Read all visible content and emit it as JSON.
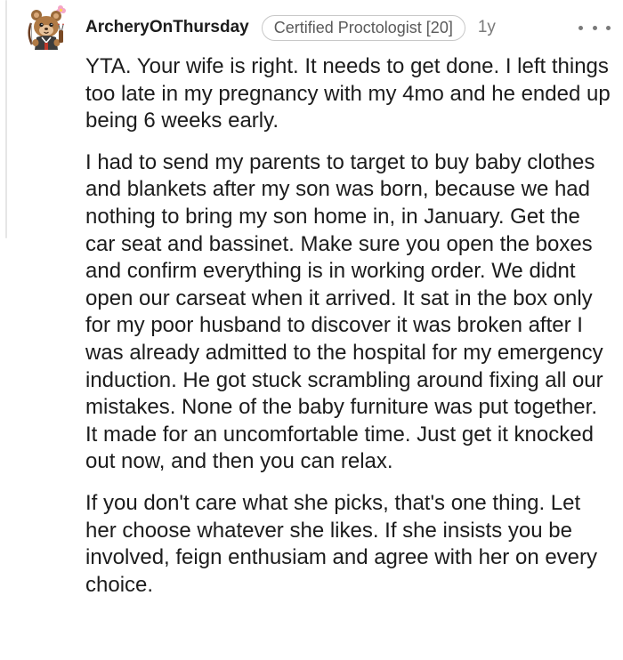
{
  "comment": {
    "username": "ArcheryOnThursday",
    "flair": "Certified Proctologist [20]",
    "age": "1y",
    "avatar": "bear-with-bow-avatar",
    "more_icon": "more-options-icon",
    "paragraphs": [
      "YTA. Your wife is right. It needs to get done. I left things too late in my pregnancy with my 4mo and he ended up being 6 weeks early.",
      "I had to send my parents to target to buy baby clothes and blankets after my son was born, because we had nothing to bring my son home in, in January. Get the car seat and bassinet. Make sure you open the boxes and confirm everything is in working order. We didnt open our carseat when it arrived. It sat in the box only for my poor husband to discover it was broken after I was already admitted to the hospital for my emergency induction. He got stuck scrambling around fixing all our mistakes. None of the baby furniture was put together. It made for an uncomfortable time. Just get it knocked out now, and then you can relax.",
      "If you don't care what she picks, that's one thing. Let her choose whatever she likes. If she insists you be involved, feign enthusiam and agree with her on every choice."
    ]
  }
}
